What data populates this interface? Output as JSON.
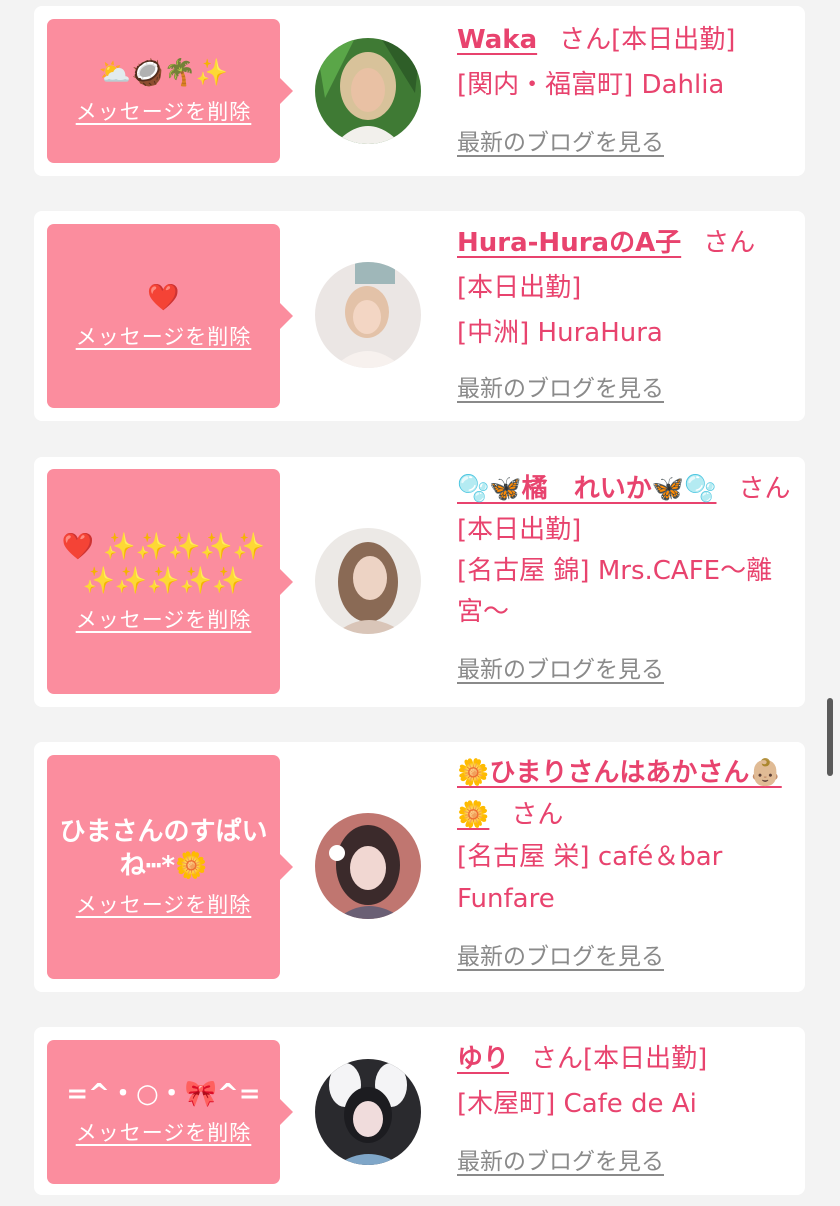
{
  "delete_label": "メッセージを削除",
  "blog_label": "最新のブログを見る",
  "honorific": "さん",
  "colors": {
    "bubble": "#fb8d9e",
    "accent": "#e8436e",
    "link_gray": "#8a8a8a",
    "background": "#f3f3f3"
  },
  "entries": [
    {
      "message": "⛅🥥🌴✨",
      "name": "Waka",
      "status": "[本日出勤]",
      "shop": "[関内・福富町] Dahlia"
    },
    {
      "message": "❤️",
      "name": "Hura-HuraのA子",
      "status": "[本日出勤]",
      "shop": "[中洲] HuraHura"
    },
    {
      "message": "❤️ ✨✨✨✨✨✨✨✨✨✨",
      "name": "🫧🦋橘　れいか🦋🫧",
      "status": "[本日出勤]",
      "shop": "[名古屋 錦] Mrs.CAFE〜離宮〜"
    },
    {
      "message": "ひまさんのすぱいね┅*🌼",
      "name": "🌼ひまりさんはあかさん👶🏼🌼",
      "status": "",
      "shop": "[名古屋 栄] café＆bar Funfare"
    },
    {
      "message": "=^・○・🎀^=",
      "name": "ゆり",
      "status": "[本日出勤]",
      "shop": "[木屋町] Cafe de Ai"
    }
  ]
}
